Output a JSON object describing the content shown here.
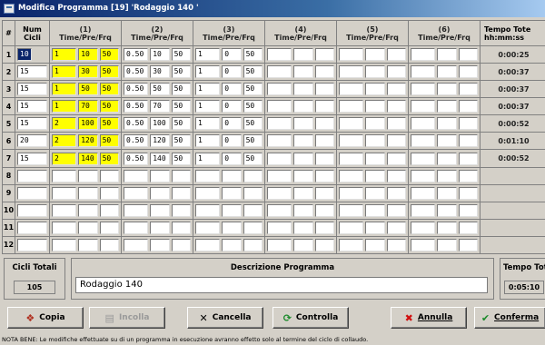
{
  "window": {
    "title": "Modifica Programma [19] 'Rodaggio 140 '"
  },
  "columns": {
    "index": "#",
    "cicli_top": "Num",
    "cicli_bottom": "Cicli",
    "groups": [
      {
        "num": "(1)",
        "sub": "Time/Pre/Frq"
      },
      {
        "num": "(2)",
        "sub": "Time/Pre/Frq"
      },
      {
        "num": "(3)",
        "sub": "Time/Pre/Frq"
      },
      {
        "num": "(4)",
        "sub": "Time/Pre/Frq"
      },
      {
        "num": "(5)",
        "sub": "Time/Pre/Frq"
      },
      {
        "num": "(6)",
        "sub": "Time/Pre/Frq"
      }
    ],
    "tempo_top": "Tempo Tote",
    "tempo_bottom": "hh:mm:ss"
  },
  "rows": [
    {
      "n": "1",
      "cicli": "10",
      "g": [
        [
          "1",
          "10",
          "50"
        ],
        [
          "0.50",
          "10",
          "50"
        ],
        [
          "1",
          "0",
          "50"
        ],
        [
          "",
          "",
          ""
        ],
        [
          "",
          "",
          ""
        ],
        [
          "",
          "",
          ""
        ]
      ],
      "tempo": "0:00:25"
    },
    {
      "n": "2",
      "cicli": "15",
      "g": [
        [
          "1",
          "30",
          "50"
        ],
        [
          "0.50",
          "30",
          "50"
        ],
        [
          "1",
          "0",
          "50"
        ],
        [
          "",
          "",
          ""
        ],
        [
          "",
          "",
          ""
        ],
        [
          "",
          "",
          ""
        ]
      ],
      "tempo": "0:00:37"
    },
    {
      "n": "3",
      "cicli": "15",
      "g": [
        [
          "1",
          "50",
          "50"
        ],
        [
          "0.50",
          "50",
          "50"
        ],
        [
          "1",
          "0",
          "50"
        ],
        [
          "",
          "",
          ""
        ],
        [
          "",
          "",
          ""
        ],
        [
          "",
          "",
          ""
        ]
      ],
      "tempo": "0:00:37"
    },
    {
      "n": "4",
      "cicli": "15",
      "g": [
        [
          "1",
          "70",
          "50"
        ],
        [
          "0.50",
          "70",
          "50"
        ],
        [
          "1",
          "0",
          "50"
        ],
        [
          "",
          "",
          ""
        ],
        [
          "",
          "",
          ""
        ],
        [
          "",
          "",
          ""
        ]
      ],
      "tempo": "0:00:37"
    },
    {
      "n": "5",
      "cicli": "15",
      "g": [
        [
          "2",
          "100",
          "50"
        ],
        [
          "0.50",
          "100",
          "50"
        ],
        [
          "1",
          "0",
          "50"
        ],
        [
          "",
          "",
          ""
        ],
        [
          "",
          "",
          ""
        ],
        [
          "",
          "",
          ""
        ]
      ],
      "tempo": "0:00:52"
    },
    {
      "n": "6",
      "cicli": "20",
      "g": [
        [
          "2",
          "120",
          "50"
        ],
        [
          "0.50",
          "120",
          "50"
        ],
        [
          "1",
          "0",
          "50"
        ],
        [
          "",
          "",
          ""
        ],
        [
          "",
          "",
          ""
        ],
        [
          "",
          "",
          ""
        ]
      ],
      "tempo": "0:01:10"
    },
    {
      "n": "7",
      "cicli": "15",
      "g": [
        [
          "2",
          "140",
          "50"
        ],
        [
          "0.50",
          "140",
          "50"
        ],
        [
          "1",
          "0",
          "50"
        ],
        [
          "",
          "",
          ""
        ],
        [
          "",
          "",
          ""
        ],
        [
          "",
          "",
          ""
        ]
      ],
      "tempo": "0:00:52"
    },
    {
      "n": "8",
      "cicli": "",
      "g": [
        [
          "",
          "",
          ""
        ],
        [
          "",
          "",
          ""
        ],
        [
          "",
          "",
          ""
        ],
        [
          "",
          "",
          ""
        ],
        [
          "",
          "",
          ""
        ],
        [
          "",
          "",
          ""
        ]
      ],
      "tempo": ""
    },
    {
      "n": "9",
      "cicli": "",
      "g": [
        [
          "",
          "",
          ""
        ],
        [
          "",
          "",
          ""
        ],
        [
          "",
          "",
          ""
        ],
        [
          "",
          "",
          ""
        ],
        [
          "",
          "",
          ""
        ],
        [
          "",
          "",
          ""
        ]
      ],
      "tempo": ""
    },
    {
      "n": "10",
      "cicli": "",
      "g": [
        [
          "",
          "",
          ""
        ],
        [
          "",
          "",
          ""
        ],
        [
          "",
          "",
          ""
        ],
        [
          "",
          "",
          ""
        ],
        [
          "",
          "",
          ""
        ],
        [
          "",
          "",
          ""
        ]
      ],
      "tempo": ""
    },
    {
      "n": "11",
      "cicli": "",
      "g": [
        [
          "",
          "",
          ""
        ],
        [
          "",
          "",
          ""
        ],
        [
          "",
          "",
          ""
        ],
        [
          "",
          "",
          ""
        ],
        [
          "",
          "",
          ""
        ],
        [
          "",
          "",
          ""
        ]
      ],
      "tempo": ""
    },
    {
      "n": "12",
      "cicli": "",
      "g": [
        [
          "",
          "",
          ""
        ],
        [
          "",
          "",
          ""
        ],
        [
          "",
          "",
          ""
        ],
        [
          "",
          "",
          ""
        ],
        [
          "",
          "",
          ""
        ],
        [
          "",
          "",
          ""
        ]
      ],
      "tempo": ""
    }
  ],
  "highlight_color": "#ffff00",
  "summary": {
    "cicli_totali_label": "Cicli Totali",
    "cicli_totali_value": "105",
    "descrizione_label": "Descrizione Programma",
    "descrizione_value": "Rodaggio 140",
    "tempo_totale_label": "Tempo Toto",
    "tempo_totale_value": "0:05:10"
  },
  "buttons": {
    "copia": "Copia",
    "incolla": "Incolla",
    "cancella": "Cancella",
    "controlla": "Controlla",
    "annulla": "Annulla",
    "conferma": "Conferma"
  },
  "note": "NOTA BENE: Le modifiche effettuate su di un programma in esecuzione avranno effetto solo al termine del ciclo di collaudo."
}
